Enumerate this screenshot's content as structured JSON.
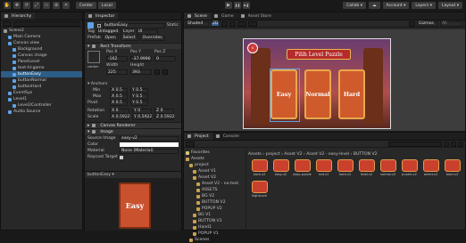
{
  "hierarchy": {
    "tab_label": "Hierarchy",
    "items": [
      {
        "label": "Scene2",
        "depth": 0
      },
      {
        "label": "Main Camera",
        "depth": 1
      },
      {
        "label": "Canvas view",
        "depth": 1
      },
      {
        "label": "Background",
        "depth": 2
      },
      {
        "label": "Canvas image",
        "depth": 2
      },
      {
        "label": "PanelLevel",
        "depth": 2
      },
      {
        "label": "text-hl-game",
        "depth": 2
      },
      {
        "label": "buttonEasy",
        "depth": 2,
        "selected": true
      },
      {
        "label": "buttonNormal",
        "depth": 2
      },
      {
        "label": "buttonHard",
        "depth": 2
      },
      {
        "label": "EventSys",
        "depth": 1
      },
      {
        "label": "Level1",
        "depth": 1
      },
      {
        "label": "Level2Controller",
        "depth": 2
      },
      {
        "label": "Audio Source",
        "depth": 1
      }
    ]
  },
  "inspector": {
    "tab_label": "Inspector",
    "object_name": "buttonEasy",
    "static_label": "Static",
    "tag_label": "Tag",
    "tag_value": "Untagged",
    "layer_label": "Layer",
    "layer_value": "UI",
    "prefab_label": "Prefab",
    "prefab_buttons": [
      "Open",
      "Select",
      "Overrides"
    ],
    "rect_transform_title": "Rect Transform",
    "anchor_preset": "center",
    "pos_headers": [
      "Pos X",
      "Pos Y",
      "Pos Z"
    ],
    "pos_values": [
      "-162",
      "-37.9996",
      "0"
    ],
    "size_headers": [
      "Width",
      "Height"
    ],
    "size_values": [
      "225",
      "393"
    ],
    "anchors_title": "Anchors",
    "anchor_min_label": "Min",
    "anchor_min": [
      "X 0.5",
      "Y 0.5"
    ],
    "anchor_max_label": "Max",
    "anchor_max": [
      "X 0.5",
      "Y 0.5"
    ],
    "pivot_label": "Pivot",
    "pivot": [
      "X 0.5",
      "Y 0.5"
    ],
    "rotation_label": "Rotation",
    "rotation": [
      "X 0",
      "Y 0",
      "Z 0"
    ],
    "scale_label": "Scale",
    "scale": [
      "X 0.5922",
      "Y 0.5922",
      "Z 0.5922"
    ],
    "canvas_renderer_title": "Canvas Renderer",
    "image_title": "Image",
    "source_image_label": "Source Image",
    "source_image_value": "easy-v2",
    "color_label": "Color",
    "material_label": "Material",
    "material_value": "None (Material)",
    "raycast_label": "Raycast Target",
    "preview_title": "buttonEasy ▾",
    "preview_label": "Easy"
  },
  "scene": {
    "tabs": [
      "Scene",
      "Game",
      "Asset Store"
    ],
    "shaded_label": "Shaded",
    "mode_2d": "2D",
    "gizmos_label": "Gizmos",
    "search_placeholder": "All",
    "game_title": "Pilih Level Puzzle",
    "buttons": [
      "Easy",
      "Normal",
      "Hard"
    ]
  },
  "toolbar": {
    "play": "▶",
    "pause": "❚❚",
    "step": "▶❚",
    "collab": "Collab",
    "account": "Account",
    "layers": "Layers",
    "layout": "Layout"
  },
  "project": {
    "tabs": [
      "Project",
      "Console"
    ],
    "breadcrumb": "Assets › project › Asset V2 › Asset V2 - easy-level › BUTTON V2",
    "favorites_label": "Favorites",
    "tree": [
      {
        "label": "Assets",
        "depth": 0
      },
      {
        "label": "project",
        "depth": 1
      },
      {
        "label": "Asset V1",
        "depth": 2
      },
      {
        "label": "Asset V2",
        "depth": 2
      },
      {
        "label": "Asset V2 - no-text",
        "depth": 3
      },
      {
        "label": "ASSETS",
        "depth": 3
      },
      {
        "label": "BG V2",
        "depth": 3
      },
      {
        "label": "BUTTON V2",
        "depth": 3
      },
      {
        "label": "POPUP V2",
        "depth": 3
      },
      {
        "label": "BG V1",
        "depth": 2
      },
      {
        "label": "BUTTON V1",
        "depth": 2
      },
      {
        "label": "Hand1",
        "depth": 2
      },
      {
        "label": "POPUP V1",
        "depth": 2
      },
      {
        "label": "Scenes",
        "depth": 1
      }
    ],
    "assets_row1": [
      "back-v2",
      "easy-v2",
      "easy-puzzle",
      "exit-v2",
      "hard-v2",
      "level-v2",
      "normal-v2",
      "puzzle-v2",
      "select-v2",
      "start-v2"
    ],
    "assets_row2": [
      "highscore"
    ]
  }
}
